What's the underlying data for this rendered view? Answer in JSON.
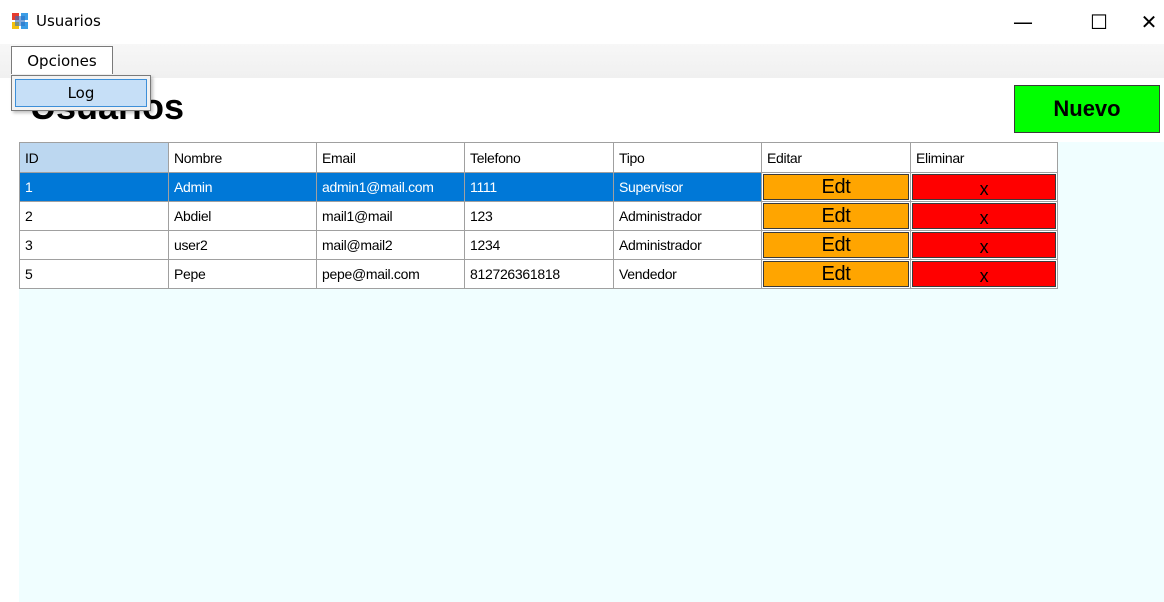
{
  "window": {
    "title": "Usuarios",
    "minimize_glyph": "—",
    "maximize_glyph": "☐",
    "close_glyph": "✕"
  },
  "menu": {
    "opciones_label": "Opciones",
    "dropdown_items": [
      {
        "label": "Log"
      }
    ]
  },
  "page": {
    "heading": "Usuarios",
    "nuevo_label": "Nuevo"
  },
  "grid": {
    "columns": [
      "ID",
      "Nombre",
      "Email",
      "Telefono",
      "Tipo",
      "Editar",
      "Eliminar"
    ],
    "edit_label": "Edt",
    "delete_label": "x",
    "rows": [
      {
        "id": "1",
        "nombre": "Admin",
        "email": "admin1@mail.com",
        "telefono": "1111",
        "tipo": "Supervisor"
      },
      {
        "id": "2",
        "nombre": "Abdiel",
        "email": "mail1@mail",
        "telefono": "123",
        "tipo": "Administrador"
      },
      {
        "id": "3",
        "nombre": "user2",
        "email": "mail@mail2",
        "telefono": "1234",
        "tipo": "Administrador"
      },
      {
        "id": "5",
        "nombre": "Pepe",
        "email": "pepe@mail.com",
        "telefono": "812726361818",
        "tipo": "Vendedor"
      }
    ]
  },
  "colors": {
    "nuevo": "#00ff00",
    "edit": "#ffa500",
    "delete": "#ff0000",
    "selection": "#0078d7",
    "panel": "#f0feff"
  },
  "icons": {
    "app": "app-window-icon"
  }
}
